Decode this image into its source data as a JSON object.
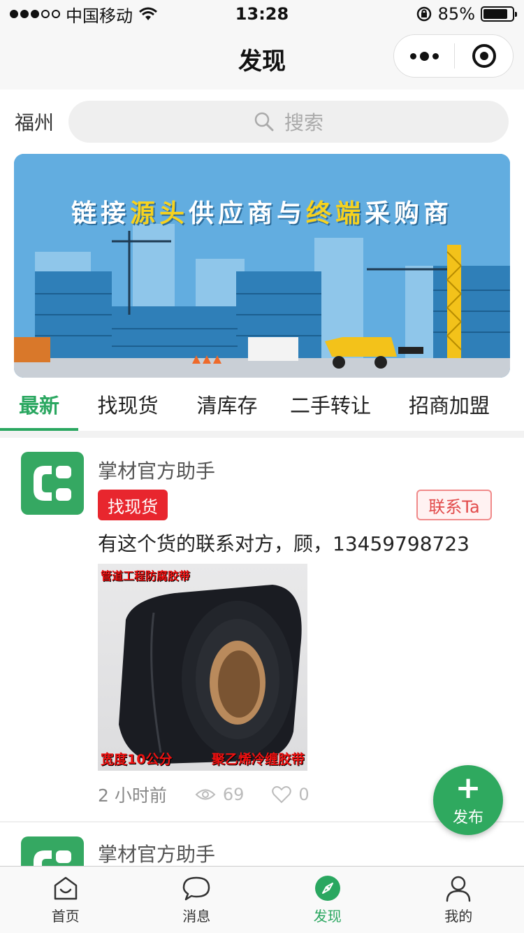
{
  "status_bar": {
    "carrier": "中国移动",
    "time": "13:28",
    "battery": "85%",
    "battery_level": 0.85
  },
  "nav": {
    "title": "发现"
  },
  "search": {
    "city": "福州",
    "placeholder": "搜索"
  },
  "banner": {
    "title_a": "链接",
    "title_b": "源头",
    "title_c": "供应商与",
    "title_d": "终端",
    "title_e": "采购商"
  },
  "tabs": [
    {
      "label": "最新",
      "active": true
    },
    {
      "label": "找现货"
    },
    {
      "label": "清库存"
    },
    {
      "label": "二手转让"
    },
    {
      "label": "招商加盟"
    }
  ],
  "posts": [
    {
      "author": "掌材官方助手",
      "tag": "找现货",
      "contact_label": "联系Ta",
      "text": "有这个货的联系对方，顾，13459798723",
      "image": {
        "top_caption": "管道工程防腐胶带",
        "bottom_left": "宽度10公分",
        "bottom_right": "聚乙烯冷缠胶带"
      },
      "time": "2 小时前",
      "views": "69",
      "likes": "0"
    },
    {
      "author": "掌材官方助手"
    }
  ],
  "fab": {
    "label": "发布"
  },
  "tab_bar": [
    {
      "label": "首页",
      "icon": "home-icon"
    },
    {
      "label": "消息",
      "icon": "chat-icon"
    },
    {
      "label": "发现",
      "icon": "compass-icon",
      "active": true
    },
    {
      "label": "我的",
      "icon": "user-icon"
    }
  ],
  "colors": {
    "accent": "#2aa760",
    "tag_red": "#e8262e",
    "banner_sky": "#62ade0"
  }
}
